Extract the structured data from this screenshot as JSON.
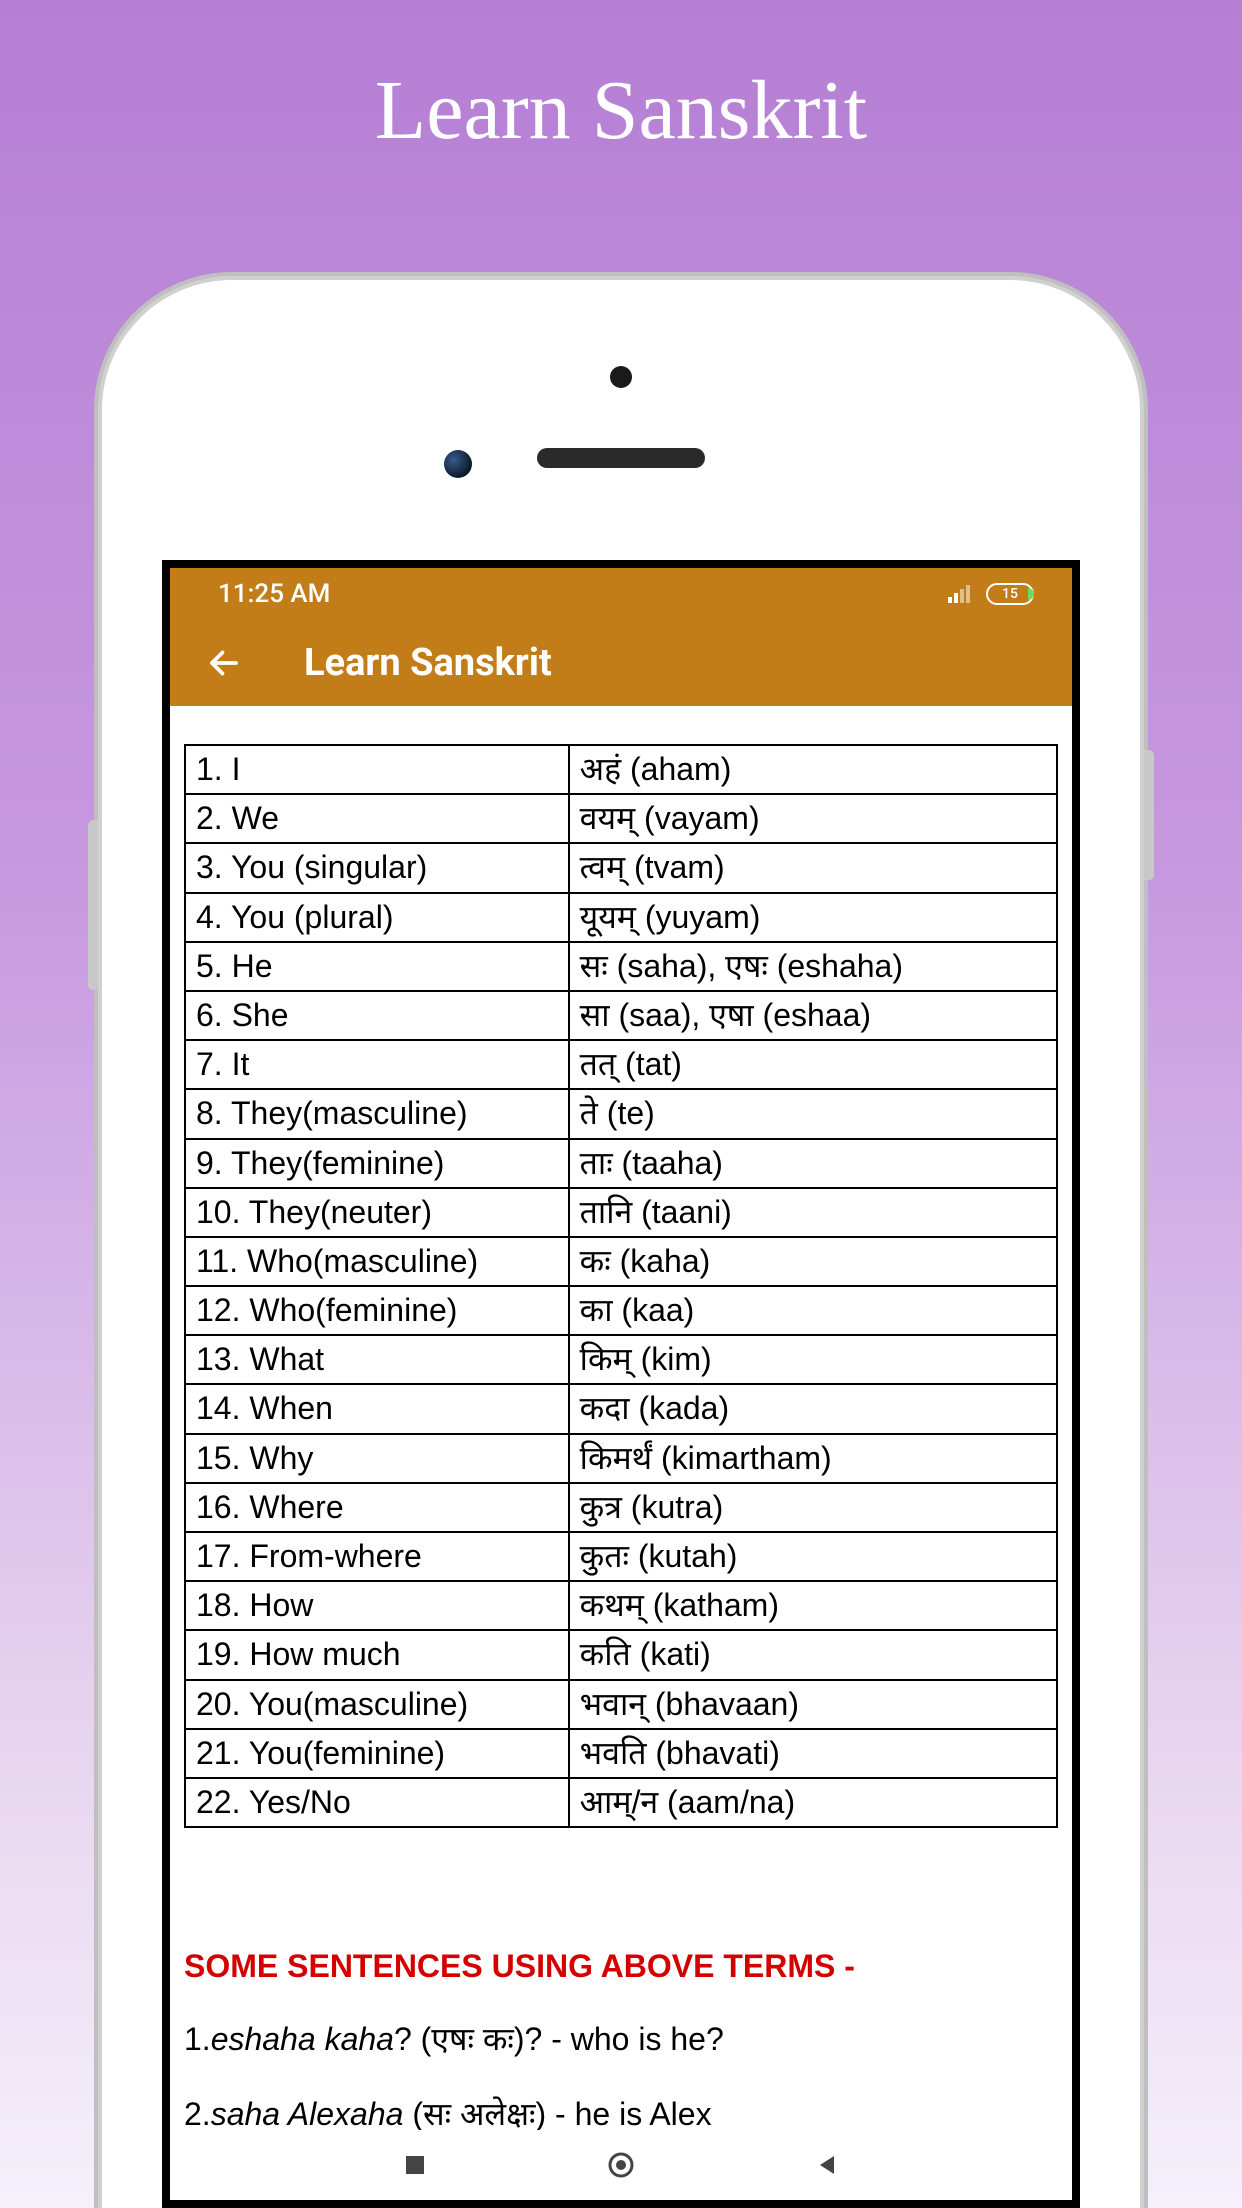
{
  "page": {
    "title": "Learn Sanskrit"
  },
  "status_bar": {
    "time": "11:25 AM",
    "battery_level": "15"
  },
  "app_bar": {
    "title": "Learn Sanskrit"
  },
  "vocabulary": {
    "rows": [
      {
        "english": "1. I",
        "sanskrit": "अहं (aham)"
      },
      {
        "english": "2. We",
        "sanskrit": "वयम् (vayam)"
      },
      {
        "english": "3. You (singular)",
        "sanskrit": "त्वम् (tvam)"
      },
      {
        "english": "4. You (plural)",
        "sanskrit": "यूयम् (yuyam)"
      },
      {
        "english": "5. He",
        "sanskrit": "सः (saha), एषः (eshaha)"
      },
      {
        "english": "6. She",
        "sanskrit": "सा (saa), एषा (eshaa)"
      },
      {
        "english": "7. It",
        "sanskrit": "तत् (tat)"
      },
      {
        "english": "8. They(masculine)",
        "sanskrit": "ते (te)"
      },
      {
        "english": "9. They(feminine)",
        "sanskrit": "ताः (taaha)"
      },
      {
        "english": "10. They(neuter)",
        "sanskrit": "तानि (taani)"
      },
      {
        "english": "11. Who(masculine)",
        "sanskrit": "कः (kaha)"
      },
      {
        "english": "12. Who(feminine)",
        "sanskrit": "का (kaa)"
      },
      {
        "english": "13. What",
        "sanskrit": "किम् (kim)"
      },
      {
        "english": "14. When",
        "sanskrit": "कदा (kada)"
      },
      {
        "english": "15. Why",
        "sanskrit": "किमर्थं (kimartham)"
      },
      {
        "english": "16. Where",
        "sanskrit": "कुत्र (kutra)"
      },
      {
        "english": "17. From-where",
        "sanskrit": "कुतः (kutah)"
      },
      {
        "english": "18. How",
        "sanskrit": "कथम् (katham)"
      },
      {
        "english": "19. How much",
        "sanskrit": "कति (kati)"
      },
      {
        "english": "20. You(masculine)",
        "sanskrit": "भवान् (bhavaan)"
      },
      {
        "english": "21. You(feminine)",
        "sanskrit": "भवति (bhavati)"
      },
      {
        "english": "22. Yes/No",
        "sanskrit": "आम्/न (aam/na)"
      }
    ]
  },
  "sentences": {
    "heading": "SOME SENTENCES USING ABOVE TERMS -",
    "items": [
      {
        "num": "1.",
        "italic": "eshaha kaha",
        "rest": "? (एषः कः)?   -  who is he?"
      },
      {
        "num": "2.",
        "italic": "saha Alexaha",
        "rest": " (सः अलेक्षः) - he is Alex"
      }
    ]
  }
}
